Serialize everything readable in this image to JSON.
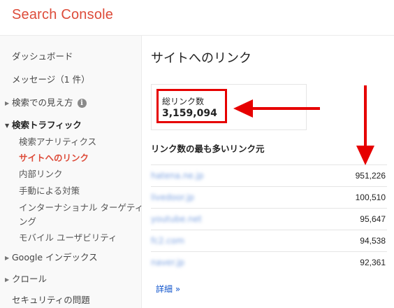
{
  "app": {
    "title": "Search Console"
  },
  "sidebar": {
    "items": [
      {
        "label": "ダッシュボード"
      },
      {
        "label": "メッセージ（1 件）"
      },
      {
        "label": "検索での見え方"
      },
      {
        "label": "検索トラフィック"
      },
      {
        "label": "検索アナリティクス"
      },
      {
        "label": "サイトへのリンク"
      },
      {
        "label": "内部リンク"
      },
      {
        "label": "手動による対策"
      },
      {
        "label": "インターナショナル ターゲティ"
      },
      {
        "label": "ング"
      },
      {
        "label": "モバイル ユーザビリティ"
      },
      {
        "label": "Google インデックス"
      },
      {
        "label": "クロール"
      },
      {
        "label": "セキュリティの問題"
      }
    ],
    "info_icon_glyph": "i",
    "active_color": "#dd4b39"
  },
  "main": {
    "title": "サイトへのリンク",
    "total": {
      "label": "総リンク数",
      "value": "3,159,094"
    },
    "top_sources": {
      "heading": "リンク数の最も多いリンク元",
      "rows": [
        {
          "domain": "hatena.ne.jp",
          "count": "951,226"
        },
        {
          "domain": "livedoor.jp",
          "count": "100,510"
        },
        {
          "domain": "youtube.net",
          "count": "95,647"
        },
        {
          "domain": "fc2.com",
          "count": "94,538"
        },
        {
          "domain": "naver.jp",
          "count": "92,361"
        }
      ]
    },
    "details_link": "詳細 »"
  },
  "annotation_color": "#e60000"
}
